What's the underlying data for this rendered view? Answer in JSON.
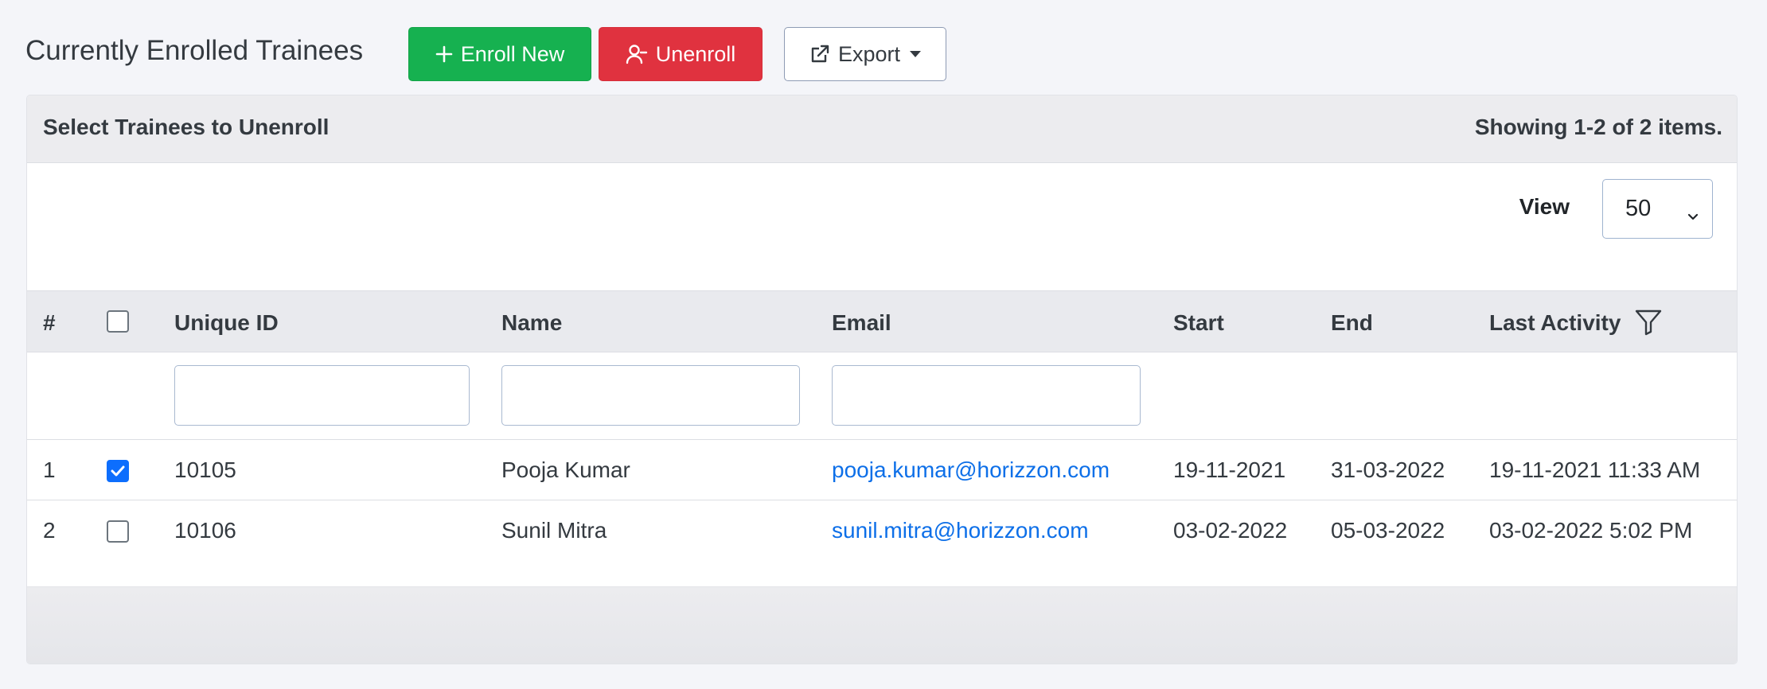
{
  "page": {
    "title": "Currently Enrolled Trainees"
  },
  "toolbar": {
    "enroll_label": "Enroll New",
    "unenroll_label": "Unenroll",
    "export_label": "Export"
  },
  "card": {
    "header_left": "Select Trainees to Unenroll",
    "header_right": "Showing 1-2 of 2 items.",
    "view_label": "View",
    "view_value": "50"
  },
  "table": {
    "headers": {
      "num": "#",
      "unique_id": "Unique ID",
      "name": "Name",
      "email": "Email",
      "start": "Start",
      "end": "End",
      "last_activity": "Last Activity"
    },
    "filters": {
      "unique_id": "",
      "name": "",
      "email": ""
    },
    "rows": [
      {
        "num": "1",
        "checked": true,
        "unique_id": "10105",
        "name": "Pooja Kumar",
        "email": "pooja.kumar@horizzon.com",
        "start": "19-11-2021",
        "end": "31-03-2022",
        "last_activity": "19-11-2021 11:33 AM"
      },
      {
        "num": "2",
        "checked": false,
        "unique_id": "10106",
        "name": "Sunil Mitra",
        "email": "sunil.mitra@horizzon.com",
        "start": "03-02-2022",
        "end": "05-03-2022",
        "last_activity": "03-02-2022 5:02 PM"
      }
    ]
  },
  "icons": {
    "enroll": "plus-icon",
    "unenroll": "user-minus-icon",
    "export": "external-link-icon",
    "filter": "funnel-filter-icon"
  },
  "colors": {
    "enroll_button": "#16b150",
    "unenroll_button": "#e0323f",
    "link": "#0d6fe8",
    "checkbox_checked": "#0d6efd"
  }
}
